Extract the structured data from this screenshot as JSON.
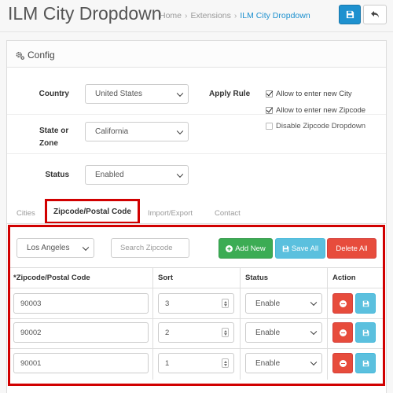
{
  "header": {
    "title": "ILM City Dropdown",
    "breadcrumb": [
      "Home",
      "Extensions",
      "ILM City Dropdown"
    ],
    "save_icon": "floppy-disk-icon",
    "back_icon": "reply-arrow-icon",
    "colors": {
      "primary": "#1e91cf"
    }
  },
  "panel": {
    "title": "Config",
    "icon": "cogs-icon"
  },
  "form": {
    "country_label": "Country",
    "country_value": "United States",
    "state_label_line1": "State or",
    "state_label_line2": "Zone",
    "state_value": "California",
    "status_label": "Status",
    "status_value": "Enabled",
    "apply_rule_label": "Apply Rule",
    "rules": [
      {
        "label": "Allow to enter new City",
        "checked": true
      },
      {
        "label": "Allow to enter new Zipcode",
        "checked": true
      },
      {
        "label": "Disable Zipcode Dropdown",
        "checked": false
      }
    ]
  },
  "tabs": [
    "Cities",
    "Zipcode/Postal Code",
    "Import/Export",
    "Contact"
  ],
  "active_tab": "Zipcode/Postal Code",
  "zip": {
    "city_select": "Los Angeles",
    "search_placeholder": "Search Zipcode",
    "add_label": "Add New",
    "save_all_label": "Save All",
    "delete_all_label": "Delete All",
    "columns": [
      "*Zipcode/Postal Code",
      "Sort",
      "Status",
      "Action"
    ],
    "rows": [
      {
        "zip": "90003",
        "sort": "3",
        "status": "Enable"
      },
      {
        "zip": "90002",
        "sort": "2",
        "status": "Enable"
      },
      {
        "zip": "90001",
        "sort": "1",
        "status": "Enable"
      }
    ],
    "colors": {
      "success": "#3cac54",
      "info": "#5bc0de",
      "danger": "#e74c3c",
      "highlight": "#d10000"
    }
  }
}
